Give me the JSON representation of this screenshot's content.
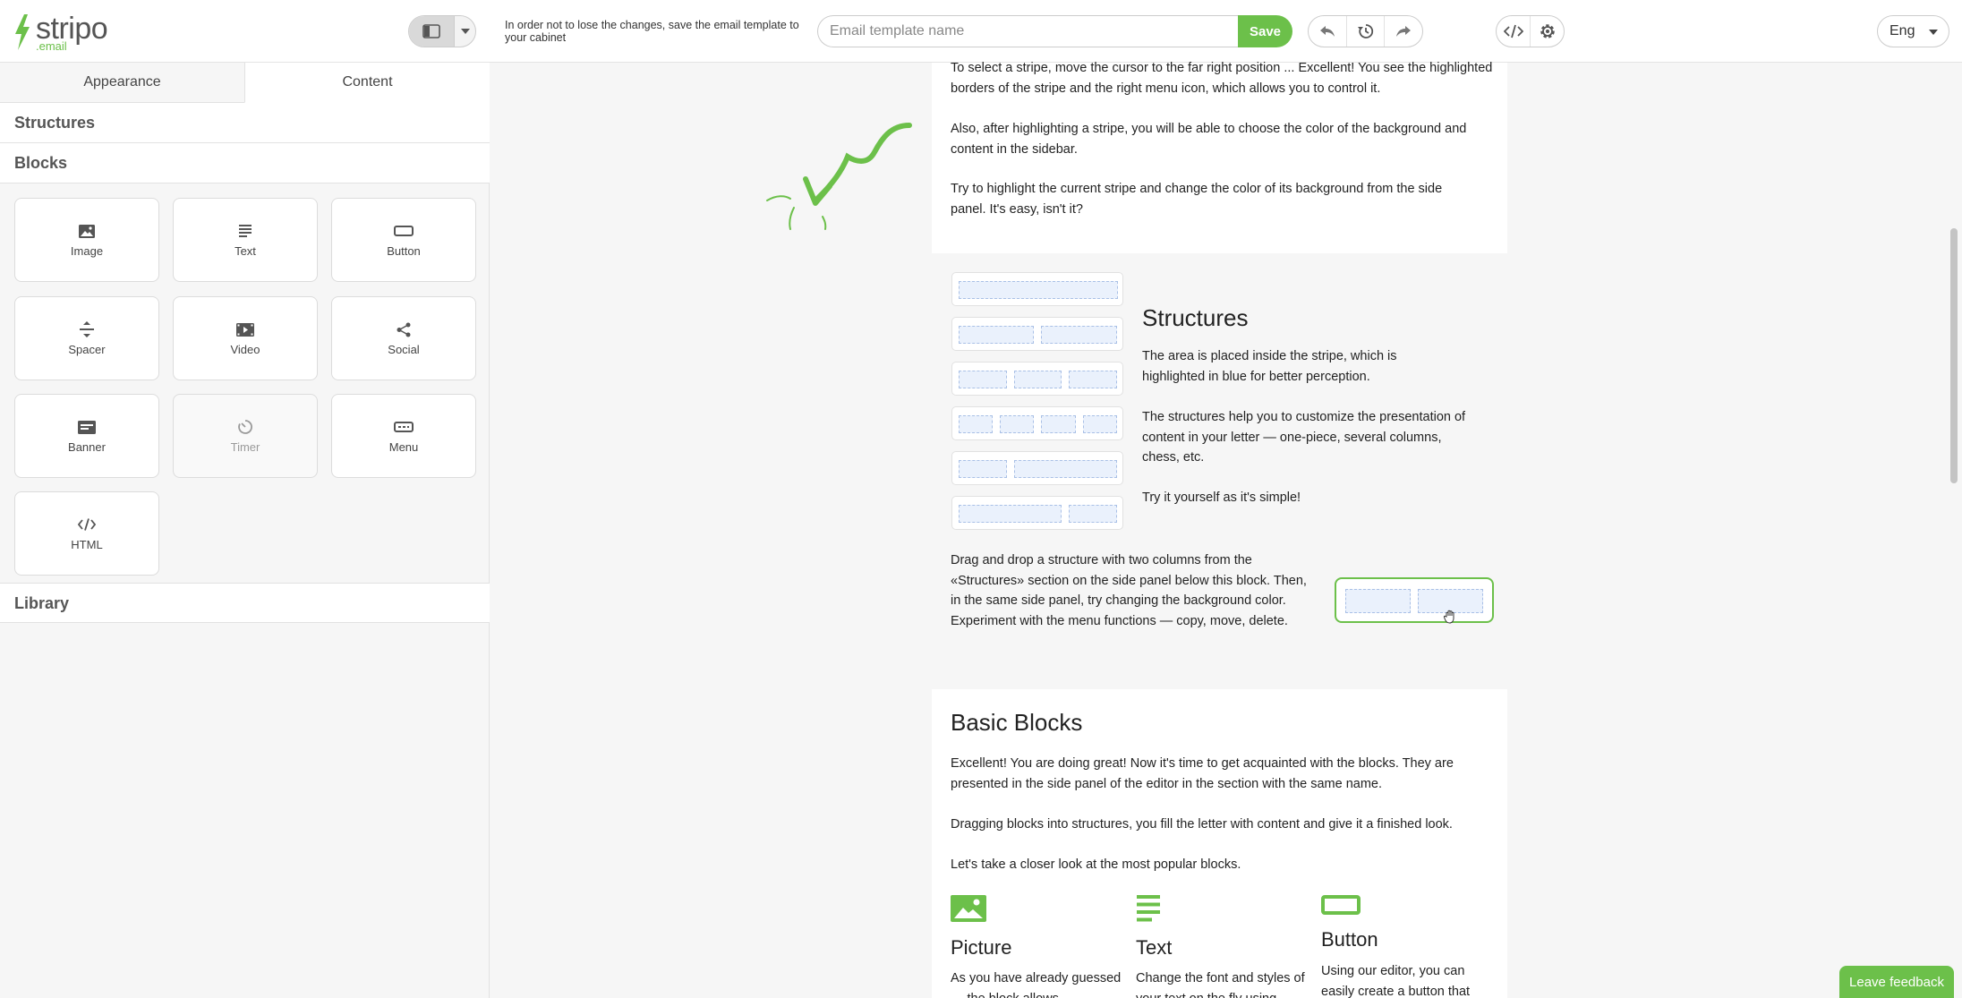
{
  "app": {
    "logo_text": "stripo",
    "logo_sub": ".email"
  },
  "header": {
    "save_hint": "In order not to lose the changes, save the email template to your cabinet",
    "template_name_placeholder": "Email template name",
    "save_label": "Save",
    "language": "Eng"
  },
  "sidebar": {
    "tabs": [
      "Appearance",
      "Content"
    ],
    "active_tab": "Content",
    "sections": {
      "structures": "Structures",
      "blocks": "Blocks",
      "library": "Library"
    },
    "blocks": [
      {
        "label": "Image",
        "icon": "image-icon",
        "enabled": true
      },
      {
        "label": "Text",
        "icon": "text-icon",
        "enabled": true
      },
      {
        "label": "Button",
        "icon": "button-icon",
        "enabled": true
      },
      {
        "label": "Spacer",
        "icon": "spacer-icon",
        "enabled": true
      },
      {
        "label": "Video",
        "icon": "video-icon",
        "enabled": true
      },
      {
        "label": "Social",
        "icon": "share-icon",
        "enabled": true
      },
      {
        "label": "Banner",
        "icon": "banner-icon",
        "enabled": true
      },
      {
        "label": "Timer",
        "icon": "timer-icon",
        "enabled": false
      },
      {
        "label": "Menu",
        "icon": "menu-icon",
        "enabled": true
      },
      {
        "label": "HTML",
        "icon": "code-icon",
        "enabled": true
      }
    ]
  },
  "content": {
    "stripe_intro": {
      "p1": "To select a stripe, move the cursor to the far right position ... Excellent! You see the highlighted borders of the stripe and the right menu icon, which allows you to control it.",
      "p2": "Also, after highlighting a stripe, you will be able to choose the color of the background and content in the sidebar.",
      "p3": "Try to highlight the current stripe and change the color of its background from the side panel. It's easy, isn't it?"
    },
    "structures": {
      "title": "Structures",
      "p1": "The area is placed inside the stripe, which is highlighted in blue for better perception.",
      "p2": "The structures help you to customize the presentation of content in your letter — one-piece, several columns, chess, etc.",
      "p3": "Try it yourself as it's simple!",
      "p4": "Drag and drop a structure with two columns from the «Structures» section on the side panel below this block. Then, in the same side panel, try changing the background color. Experiment with the menu functions — copy, move, delete."
    },
    "basic_blocks": {
      "title": "Basic Blocks",
      "p1": "Excellent! You are doing great! Now it's time to get acquainted with the blocks. They are presented in the side panel of the editor in the section with the same name.",
      "p2": "Dragging blocks into structures, you fill the letter with content and give it a finished look.",
      "p3": "Let's take a closer look at the most popular blocks.",
      "columns": [
        {
          "title": "Picture",
          "text": "As you have already guessed — the block allows",
          "icon": "picture-icon"
        },
        {
          "title": "Text",
          "text": "Change the font and styles of your text on the fly using",
          "icon": "text-lines-icon"
        },
        {
          "title": "Button",
          "text": "Using our editor, you can easily create a button that",
          "icon": "button-outline-icon"
        }
      ]
    }
  },
  "feedback_label": "Leave feedback",
  "colors": {
    "accent": "#6cc04a",
    "structure_fill": "#eaf1fc",
    "structure_border": "#a9c0e6"
  }
}
